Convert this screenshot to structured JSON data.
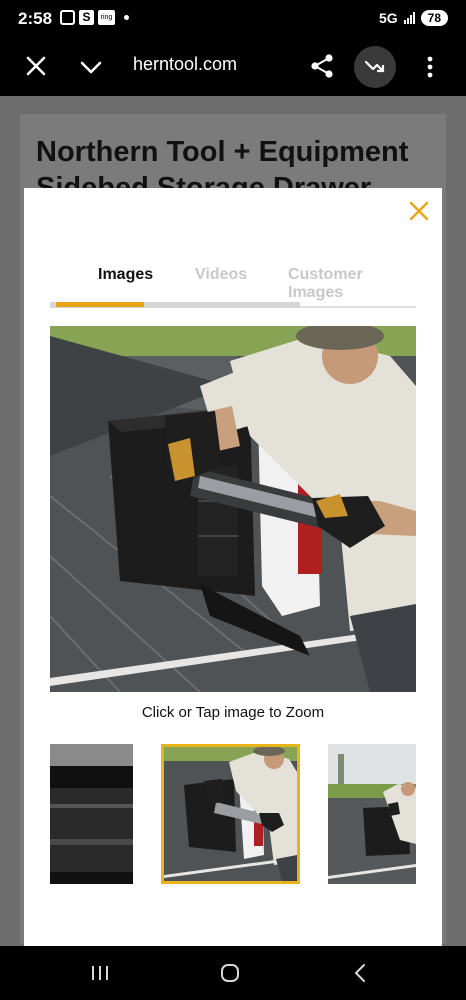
{
  "status_bar": {
    "time": "2:58",
    "app_badge": "S",
    "ring_badge": "ring",
    "network": "5G",
    "battery": "78"
  },
  "browser": {
    "url": "herntool.com",
    "icons": [
      "close-icon",
      "chevron-down-icon",
      "share-icon",
      "trend-icon",
      "more-vert-icon"
    ]
  },
  "page": {
    "title": "Northern Tool + Equipment Sidebed Storage Drawer Truck"
  },
  "modal": {
    "tabs": [
      {
        "label": "Images",
        "active": true
      },
      {
        "label": "Videos",
        "active": false
      },
      {
        "label": "Customer Images",
        "active": false
      }
    ],
    "caption": "Click or Tap image to Zoom",
    "thumbnails": [
      {
        "selected": false
      },
      {
        "selected": true
      },
      {
        "selected": false
      }
    ],
    "accent_color": "#e8a317"
  },
  "nav_bar": {
    "icons": [
      "recents-icon",
      "home-icon",
      "back-icon"
    ]
  }
}
